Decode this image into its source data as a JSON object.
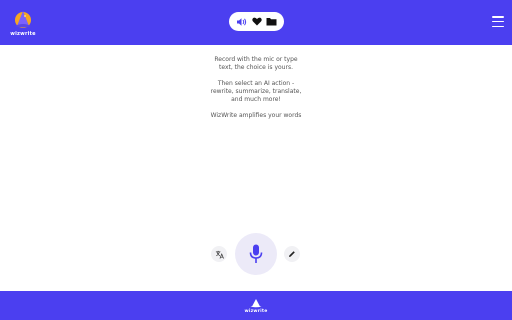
{
  "header": {
    "logo_text": "wizwrite",
    "toolbar": {
      "icons": [
        "speaker-icon",
        "heart-icon",
        "folder-icon"
      ]
    },
    "menu_icon": "hamburger-menu-icon"
  },
  "intro": {
    "line1": "Record with the mic or type",
    "line2": "text, the choice is yours.",
    "line3": "Then select an AI action -",
    "line4": "rewrite, summarize, translate,",
    "line5": "and much more!",
    "line6": "WizWrite amplifies your words"
  },
  "controls": {
    "left_icon": "translate-icon",
    "center_icon": "microphone-icon",
    "right_icon": "pencil-icon"
  },
  "footer": {
    "logo_text": "wizwrite"
  },
  "colors": {
    "brand": "#4b3ff0",
    "mic": "#4b3ff0",
    "mic_bg": "#eceaf8"
  }
}
